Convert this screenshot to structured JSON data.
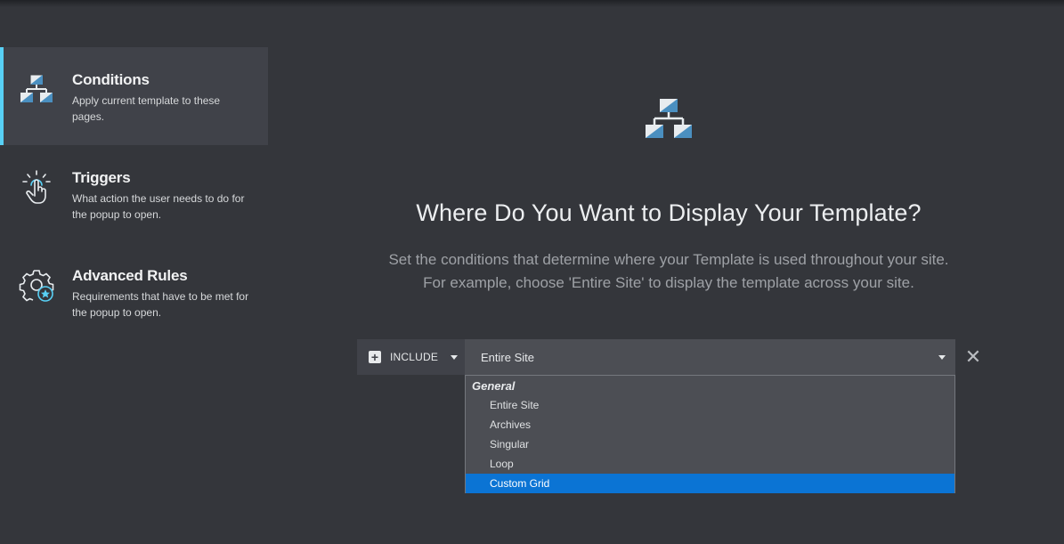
{
  "sidebar": {
    "tabs": [
      {
        "title": "Conditions",
        "desc": "Apply current template to these pages.",
        "icon": "sitemap-icon",
        "active": true
      },
      {
        "title": "Triggers",
        "desc": "What action the user needs to do for the popup to open.",
        "icon": "tap-gesture-icon",
        "active": false
      },
      {
        "title": "Advanced Rules",
        "desc": "Requirements that have to be met for the popup to open.",
        "icon": "gear-star-icon",
        "active": false
      }
    ]
  },
  "main": {
    "hero_icon": "sitemap-icon",
    "heading": "Where Do You Want to Display Your Template?",
    "subtext_line1": "Set the conditions that determine where your Template is used throughout your site.",
    "subtext_line2": "For example, choose 'Entire Site' to display the template across your site."
  },
  "condition": {
    "include_label": "INCLUDE",
    "selected_value": "Entire Site",
    "remove_icon": "close-icon",
    "dropdown": {
      "group_label": "General",
      "options": [
        "Entire Site",
        "Archives",
        "Singular",
        "Loop",
        "Custom Grid"
      ],
      "highlighted": "Custom Grid"
    }
  },
  "colors": {
    "background": "#34363b",
    "active_tab": "#404249",
    "accent_bar": "#58d0f5",
    "highlight": "#0b74d4"
  }
}
